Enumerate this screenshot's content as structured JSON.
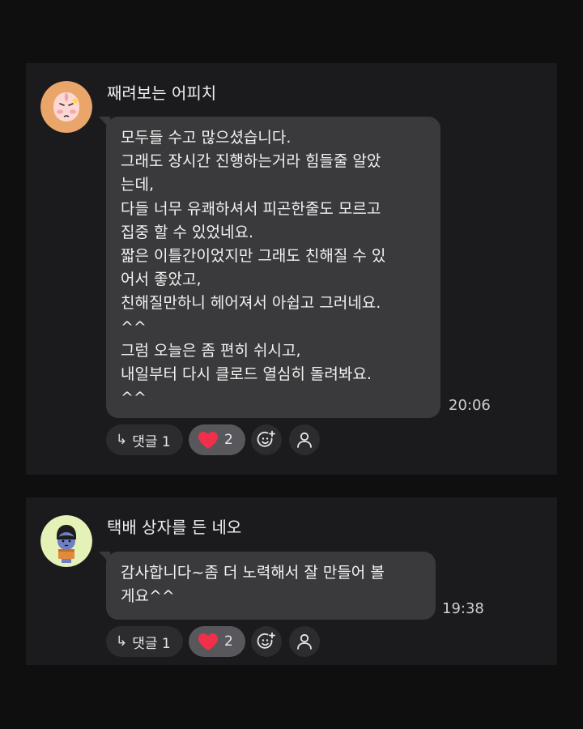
{
  "messages": [
    {
      "sender": "째려보는 어피치",
      "avatar_icon": "apeach-glaring-avatar-icon",
      "lines": [
        "모두들 수고 많으셨습니다.",
        "그래도 장시간 진행하는거라 힘들줄 알았",
        "는데,",
        "다들 너무 유쾌하셔서 피곤한줄도 모르고",
        "집중 할 수 있었네요.",
        "짧은 이틀간이었지만 그래도 친해질 수 있",
        "어서 좋았고,",
        "친해질만하니 헤어져서 아쉽고 그러네요.",
        "^^",
        "그럼 오늘은 좀 편히 쉬시고,",
        "내일부터 다시 클로드 열심히 돌려봐요.",
        "^^"
      ],
      "time": "20:06",
      "reply_label": "댓글 1",
      "heart_count": "2"
    },
    {
      "sender": "택배 상자를 든 네오",
      "avatar_icon": "neo-holding-box-avatar-icon",
      "lines": [
        "감사합니다~좀 더 노력해서 잘 만들어 볼",
        "게요^^"
      ],
      "time": "19:38",
      "reply_label": "댓글 1",
      "heart_count": "2"
    }
  ],
  "icons": {
    "reply": "reply-arrow-icon",
    "heart": "heart-icon",
    "add_reaction": "add-emoji-icon",
    "reactors": "user-icon"
  },
  "colors": {
    "background": "#0f0f10",
    "card": "#1b1b1d",
    "bubble": "#3a3a3c",
    "heart": "#f0304a",
    "apeach_bg": "#e9a56a",
    "neo_bg": "#e4f1b7"
  }
}
